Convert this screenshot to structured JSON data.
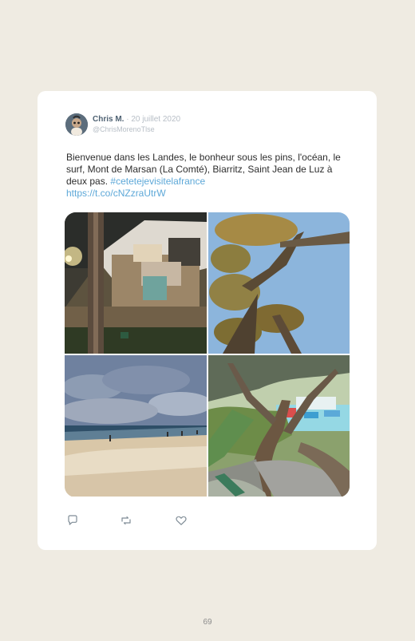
{
  "tweet": {
    "author_name": "Chris M.",
    "separator": "·",
    "date": "20 juillet 2020",
    "handle": "@ChrisMorenoTlse",
    "text": "Bienvenue dans les Landes, le bonheur sous les pins, l'océan, le surf, Mont de Marsan (La Comté), Biarritz, Saint Jean de Luz à deux pas.",
    "hashtag": "#cetetejevisitelafrance",
    "url": "https://t.co/cNZzraUtrW"
  },
  "photos": [
    {
      "id": "tent-photo",
      "label": "Tente lodge sous les pins"
    },
    {
      "id": "pines-photo",
      "label": "Pins vus d'en bas"
    },
    {
      "id": "beach-photo",
      "label": "Plage de l'océan"
    },
    {
      "id": "tree-view-photo",
      "label": "Vue sur la mer depuis un arbre"
    }
  ],
  "actions": [
    {
      "id": "reply",
      "icon": "reply-icon"
    },
    {
      "id": "retweet",
      "icon": "retweet-icon"
    },
    {
      "id": "like",
      "icon": "heart-icon"
    }
  ],
  "page": {
    "number": "69"
  },
  "colors": {
    "page_bg": "#efebe2",
    "card_bg": "#ffffff",
    "author": "#4f6273",
    "meta": "#b7bec6",
    "link": "#5da8d8",
    "text": "#2d2d2d",
    "icon": "#7f8c96"
  }
}
